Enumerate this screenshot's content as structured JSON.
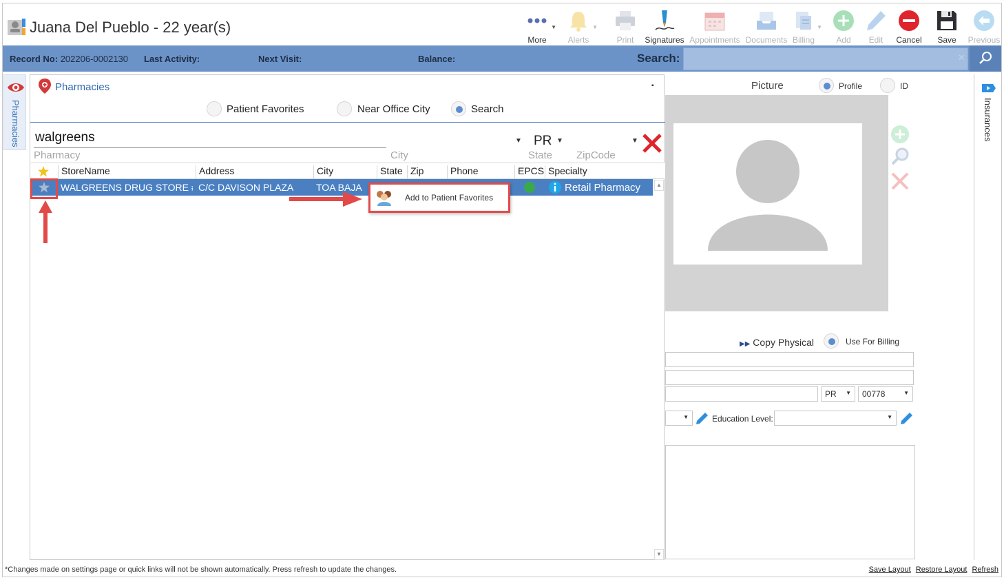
{
  "header": {
    "patient_name": "Juana Del Pueblo - 22 year(s)",
    "toolbar": [
      {
        "id": "more",
        "label": "More",
        "icon": "more-dots-icon",
        "enabled": true
      },
      {
        "id": "alerts",
        "label": "Alerts",
        "icon": "bell-icon",
        "enabled": false
      },
      {
        "id": "print",
        "label": "Print",
        "icon": "printer-icon",
        "enabled": false
      },
      {
        "id": "signatures",
        "label": "Signatures",
        "icon": "signature-pen-icon",
        "enabled": true
      },
      {
        "id": "appointments",
        "label": "Appointments",
        "icon": "calendar-icon",
        "enabled": false
      },
      {
        "id": "documents",
        "label": "Documents",
        "icon": "tray-icon",
        "enabled": false
      },
      {
        "id": "billing",
        "label": "Billing",
        "icon": "billing-icon",
        "enabled": false
      },
      {
        "id": "add",
        "label": "Add",
        "icon": "plus-circle-icon",
        "enabled": false
      },
      {
        "id": "edit",
        "label": "Edit",
        "icon": "pencil-icon",
        "enabled": false
      },
      {
        "id": "cancel",
        "label": "Cancel",
        "icon": "minus-circle-icon",
        "enabled": true
      },
      {
        "id": "save",
        "label": "Save",
        "icon": "floppy-disk-icon",
        "enabled": true
      },
      {
        "id": "previous",
        "label": "Previous",
        "icon": "back-arrow-icon",
        "enabled": false
      }
    ]
  },
  "infobar": {
    "record_label": "Record No:",
    "record_value": "202206-0002130",
    "last_activity_label": "Last Activity:",
    "next_visit_label": "Next Visit:",
    "balance_label": "Balance:",
    "search_label": "Search:"
  },
  "side_tabs": {
    "left": "Pharmacies",
    "right": "Insurances"
  },
  "pharmacies": {
    "title": "Pharmacies",
    "radios": [
      {
        "label": "Patient Favorites",
        "selected": false
      },
      {
        "label": "Near Office City",
        "selected": false
      },
      {
        "label": "Search",
        "selected": true
      }
    ],
    "search_value": "walgreens",
    "pharmacy_label": "Pharmacy",
    "city_label": "City",
    "state_value": "PR",
    "state_label": "State",
    "zip_label": "ZipCode",
    "columns": [
      "StoreName",
      "Address",
      "City",
      "State",
      "Zip",
      "Phone",
      "EPCS",
      "Specialty"
    ],
    "rows": [
      {
        "storename": "WALGREENS DRUG STORE #...",
        "address": "C/C DAVISON PLAZA",
        "city": "TOA BAJA",
        "state": "",
        "zip": "",
        "phone": "",
        "epcs": "green",
        "specialty": "Retail Pharmacy"
      }
    ],
    "context_menu": {
      "label": "Add to Patient Favorites"
    }
  },
  "right_panel": {
    "picture_label": "Picture",
    "profile_label": "Profile",
    "id_label": "ID",
    "profile_selected": true,
    "copy_physical": "Copy Physical",
    "use_for_billing": "Use For Billing",
    "state_value": "PR",
    "zip_value": "00778",
    "education_label": "Education Level:"
  },
  "footer": {
    "note": "*Changes made on settings page or quick links will not be shown automatically. Press refresh to update the changes.",
    "save_layout": "Save Layout",
    "restore_layout": "Restore Layout",
    "refresh": "Refresh"
  },
  "colors": {
    "accent_blue": "#6b93c8",
    "selection_blue": "#4a80c2",
    "highlight_red": "#e24a4a",
    "disabled": "#b5b5b5"
  }
}
